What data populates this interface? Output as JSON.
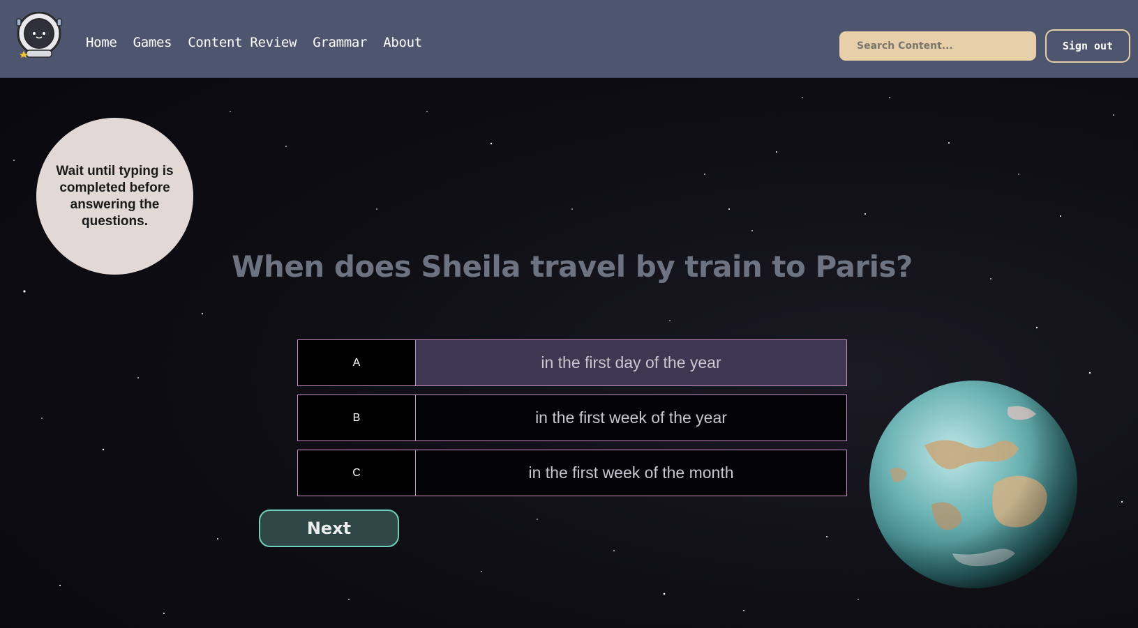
{
  "nav": {
    "logo_icon": "astronaut-logo-icon",
    "links": [
      "Home",
      "Games",
      "Content Review",
      "Grammar",
      "About"
    ],
    "search_placeholder": "Search Content...",
    "signout_label": "Sign out"
  },
  "tip": {
    "text": "Wait until typing is completed before answering the questions."
  },
  "quiz": {
    "question": "When does Sheila travel by train to Paris?",
    "answers": [
      {
        "letter": "A",
        "text": "in the first day of the year"
      },
      {
        "letter": "B",
        "text": "in the first week of the year"
      },
      {
        "letter": "C",
        "text": "in the first week of the month"
      }
    ],
    "next_label": "Next"
  },
  "colors": {
    "navbar": "#4e566f",
    "search_bg": "#e6cfa9",
    "answer_border": "#c98bc2",
    "answer_highlight": "#3d3752",
    "next_border": "#6fd0be",
    "next_bg": "#2f4847"
  },
  "decor": {
    "planet_icon": "planet-image"
  }
}
